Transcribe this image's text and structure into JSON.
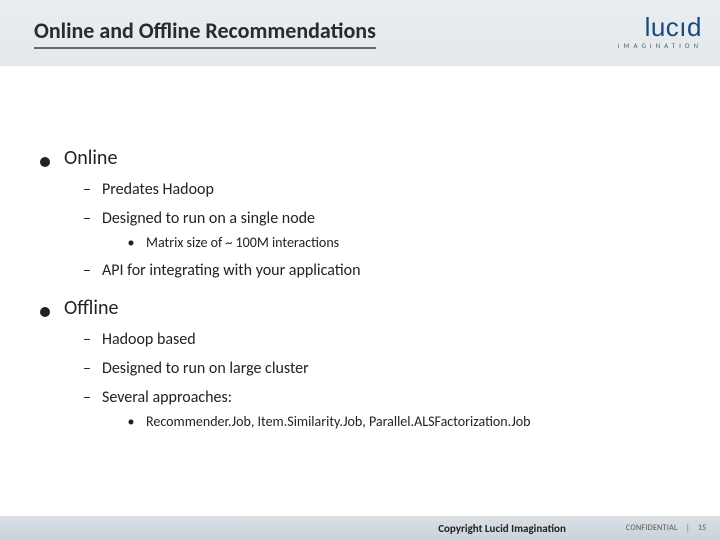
{
  "header": {
    "title": "Online and Offline Recommendations",
    "logo_main_part1": "lucı",
    "logo_main_part2": "d",
    "logo_sub": "IMAGINATION"
  },
  "body": {
    "section1": {
      "heading": "Online",
      "items": [
        "Predates Hadoop",
        "Designed to run on a single node",
        "API for integrating with your application"
      ],
      "sub_after_item2": "Matrix size of ~ 100M interactions"
    },
    "section2": {
      "heading": "Offline",
      "items": [
        "Hadoop based",
        "Designed to run on large cluster",
        "Several approaches:"
      ],
      "sub_after_item3": "Recommender.Job, Item.Similarity.Job, Parallel.ALSFactorization.Job"
    }
  },
  "footer": {
    "copyright": "Copyright Lucid Imagination",
    "confidential": "CONFIDENTIAL",
    "separator": "|",
    "page": "15"
  }
}
